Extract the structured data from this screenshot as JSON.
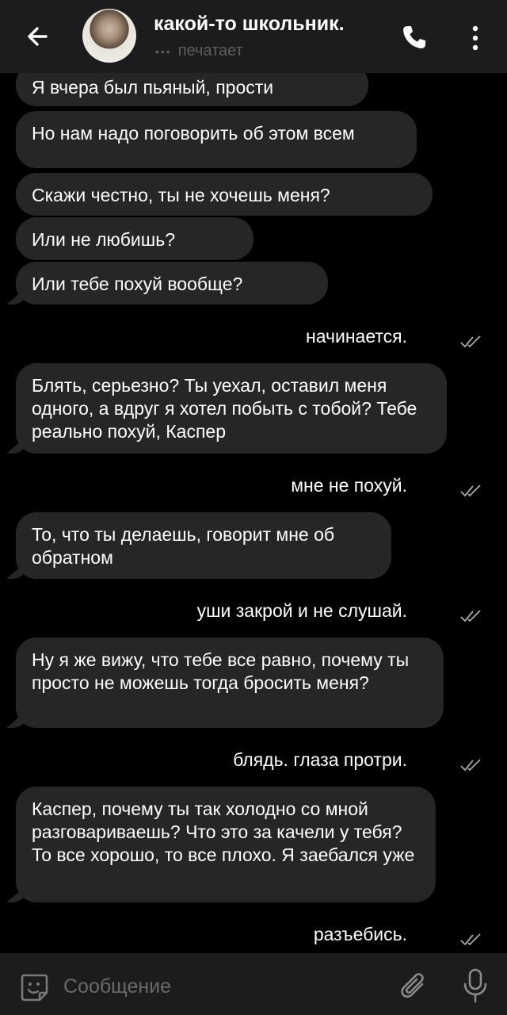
{
  "header": {
    "back_icon": "arrow-left-icon",
    "title": "какой-то школьник.",
    "status_dots": "•••",
    "status": "печатает",
    "call_icon": "phone-icon",
    "menu_icon": "more-vertical-icon"
  },
  "messages": [
    {
      "side": "in",
      "text": "Я вчера был пьяный, прости"
    },
    {
      "side": "in",
      "text": "Но нам надо поговорить об этом всем"
    },
    {
      "side": "in",
      "text": "Скажи честно, ты не хочешь меня?"
    },
    {
      "side": "in",
      "text": "Или не любишь?"
    },
    {
      "side": "in",
      "text": "Или тебе похуй вообще?"
    },
    {
      "side": "out",
      "text": "начинается."
    },
    {
      "side": "in",
      "text": "Блять, серьезно? Ты уехал, оставил меня одного, а вдруг я хотел побыть с тобой? Тебе реально похуй, Каспер"
    },
    {
      "side": "out",
      "text": "мне не похуй."
    },
    {
      "side": "in",
      "text": "То, что ты делаешь, говорит мне об обратном"
    },
    {
      "side": "out",
      "text": "уши закрой и не слушай."
    },
    {
      "side": "in",
      "text": "Ну я же вижу, что тебе все равно, почему ты просто не можешь тогда бросить меня?"
    },
    {
      "side": "out",
      "text": "блядь. глаза протри."
    },
    {
      "side": "in",
      "text": "Каспер, почему ты так холодно со мной разговариваешь? Что это за качели у тебя? То все хорошо, то все плохо. Я заебался уже"
    },
    {
      "side": "out",
      "text": "разъебись."
    }
  ],
  "composer": {
    "placeholder": "Сообщение",
    "emoji_icon": "emoji-icon",
    "attach_icon": "paperclip-icon",
    "mic_icon": "microphone-icon"
  },
  "colors": {
    "background": "#000000",
    "bar": "#1c1c1e",
    "incoming_bubble": "#262628",
    "muted_text": "#5e5e63"
  }
}
